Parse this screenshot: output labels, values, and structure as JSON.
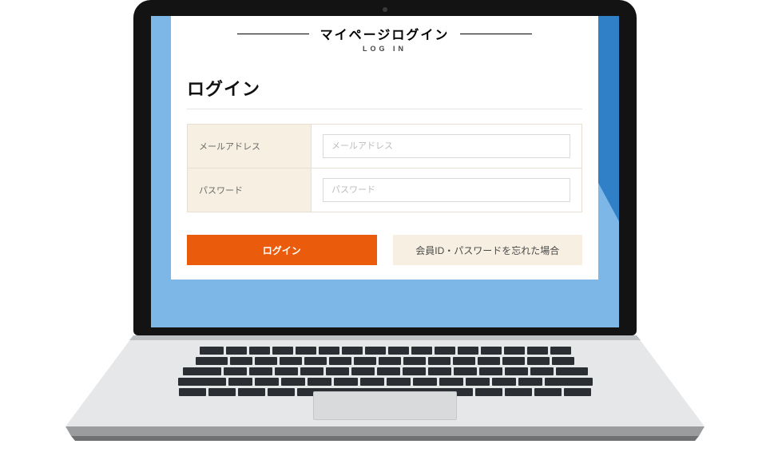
{
  "header": {
    "title": "マイページログイン",
    "subtitle": "LOG IN"
  },
  "section": {
    "heading": "ログイン"
  },
  "form": {
    "email": {
      "label": "メールアドレス",
      "placeholder": "メールアドレス",
      "value": ""
    },
    "password": {
      "label": "パスワード",
      "placeholder": "パスワード",
      "value": ""
    }
  },
  "buttons": {
    "login": "ログイン",
    "forgot": "会員ID・パスワードを忘れた場合"
  }
}
